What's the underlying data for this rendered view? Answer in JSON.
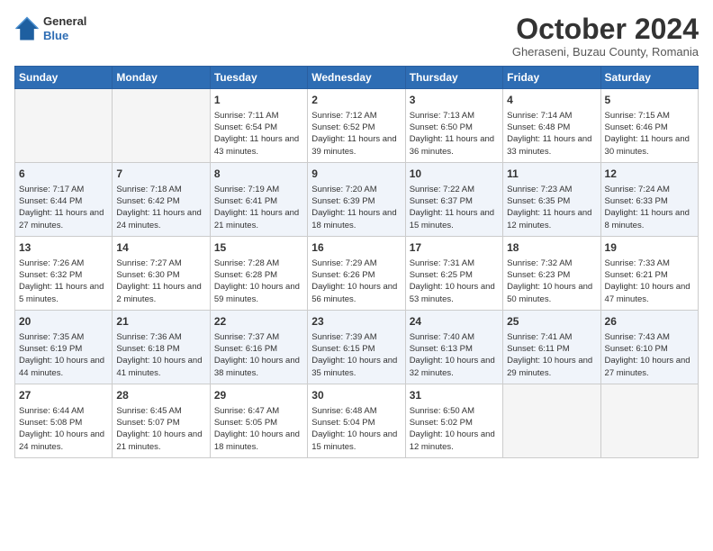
{
  "header": {
    "logo": {
      "general": "General",
      "blue": "Blue"
    },
    "title": "October 2024",
    "subtitle": "Gheraseni, Buzau County, Romania"
  },
  "weekdays": [
    "Sunday",
    "Monday",
    "Tuesday",
    "Wednesday",
    "Thursday",
    "Friday",
    "Saturday"
  ],
  "weeks": [
    [
      {
        "day": "",
        "info": ""
      },
      {
        "day": "",
        "info": ""
      },
      {
        "day": "1",
        "info": "Sunrise: 7:11 AM\nSunset: 6:54 PM\nDaylight: 11 hours and 43 minutes."
      },
      {
        "day": "2",
        "info": "Sunrise: 7:12 AM\nSunset: 6:52 PM\nDaylight: 11 hours and 39 minutes."
      },
      {
        "day": "3",
        "info": "Sunrise: 7:13 AM\nSunset: 6:50 PM\nDaylight: 11 hours and 36 minutes."
      },
      {
        "day": "4",
        "info": "Sunrise: 7:14 AM\nSunset: 6:48 PM\nDaylight: 11 hours and 33 minutes."
      },
      {
        "day": "5",
        "info": "Sunrise: 7:15 AM\nSunset: 6:46 PM\nDaylight: 11 hours and 30 minutes."
      }
    ],
    [
      {
        "day": "6",
        "info": "Sunrise: 7:17 AM\nSunset: 6:44 PM\nDaylight: 11 hours and 27 minutes."
      },
      {
        "day": "7",
        "info": "Sunrise: 7:18 AM\nSunset: 6:42 PM\nDaylight: 11 hours and 24 minutes."
      },
      {
        "day": "8",
        "info": "Sunrise: 7:19 AM\nSunset: 6:41 PM\nDaylight: 11 hours and 21 minutes."
      },
      {
        "day": "9",
        "info": "Sunrise: 7:20 AM\nSunset: 6:39 PM\nDaylight: 11 hours and 18 minutes."
      },
      {
        "day": "10",
        "info": "Sunrise: 7:22 AM\nSunset: 6:37 PM\nDaylight: 11 hours and 15 minutes."
      },
      {
        "day": "11",
        "info": "Sunrise: 7:23 AM\nSunset: 6:35 PM\nDaylight: 11 hours and 12 minutes."
      },
      {
        "day": "12",
        "info": "Sunrise: 7:24 AM\nSunset: 6:33 PM\nDaylight: 11 hours and 8 minutes."
      }
    ],
    [
      {
        "day": "13",
        "info": "Sunrise: 7:26 AM\nSunset: 6:32 PM\nDaylight: 11 hours and 5 minutes."
      },
      {
        "day": "14",
        "info": "Sunrise: 7:27 AM\nSunset: 6:30 PM\nDaylight: 11 hours and 2 minutes."
      },
      {
        "day": "15",
        "info": "Sunrise: 7:28 AM\nSunset: 6:28 PM\nDaylight: 10 hours and 59 minutes."
      },
      {
        "day": "16",
        "info": "Sunrise: 7:29 AM\nSunset: 6:26 PM\nDaylight: 10 hours and 56 minutes."
      },
      {
        "day": "17",
        "info": "Sunrise: 7:31 AM\nSunset: 6:25 PM\nDaylight: 10 hours and 53 minutes."
      },
      {
        "day": "18",
        "info": "Sunrise: 7:32 AM\nSunset: 6:23 PM\nDaylight: 10 hours and 50 minutes."
      },
      {
        "day": "19",
        "info": "Sunrise: 7:33 AM\nSunset: 6:21 PM\nDaylight: 10 hours and 47 minutes."
      }
    ],
    [
      {
        "day": "20",
        "info": "Sunrise: 7:35 AM\nSunset: 6:19 PM\nDaylight: 10 hours and 44 minutes."
      },
      {
        "day": "21",
        "info": "Sunrise: 7:36 AM\nSunset: 6:18 PM\nDaylight: 10 hours and 41 minutes."
      },
      {
        "day": "22",
        "info": "Sunrise: 7:37 AM\nSunset: 6:16 PM\nDaylight: 10 hours and 38 minutes."
      },
      {
        "day": "23",
        "info": "Sunrise: 7:39 AM\nSunset: 6:15 PM\nDaylight: 10 hours and 35 minutes."
      },
      {
        "day": "24",
        "info": "Sunrise: 7:40 AM\nSunset: 6:13 PM\nDaylight: 10 hours and 32 minutes."
      },
      {
        "day": "25",
        "info": "Sunrise: 7:41 AM\nSunset: 6:11 PM\nDaylight: 10 hours and 29 minutes."
      },
      {
        "day": "26",
        "info": "Sunrise: 7:43 AM\nSunset: 6:10 PM\nDaylight: 10 hours and 27 minutes."
      }
    ],
    [
      {
        "day": "27",
        "info": "Sunrise: 6:44 AM\nSunset: 5:08 PM\nDaylight: 10 hours and 24 minutes."
      },
      {
        "day": "28",
        "info": "Sunrise: 6:45 AM\nSunset: 5:07 PM\nDaylight: 10 hours and 21 minutes."
      },
      {
        "day": "29",
        "info": "Sunrise: 6:47 AM\nSunset: 5:05 PM\nDaylight: 10 hours and 18 minutes."
      },
      {
        "day": "30",
        "info": "Sunrise: 6:48 AM\nSunset: 5:04 PM\nDaylight: 10 hours and 15 minutes."
      },
      {
        "day": "31",
        "info": "Sunrise: 6:50 AM\nSunset: 5:02 PM\nDaylight: 10 hours and 12 minutes."
      },
      {
        "day": "",
        "info": ""
      },
      {
        "day": "",
        "info": ""
      }
    ]
  ]
}
